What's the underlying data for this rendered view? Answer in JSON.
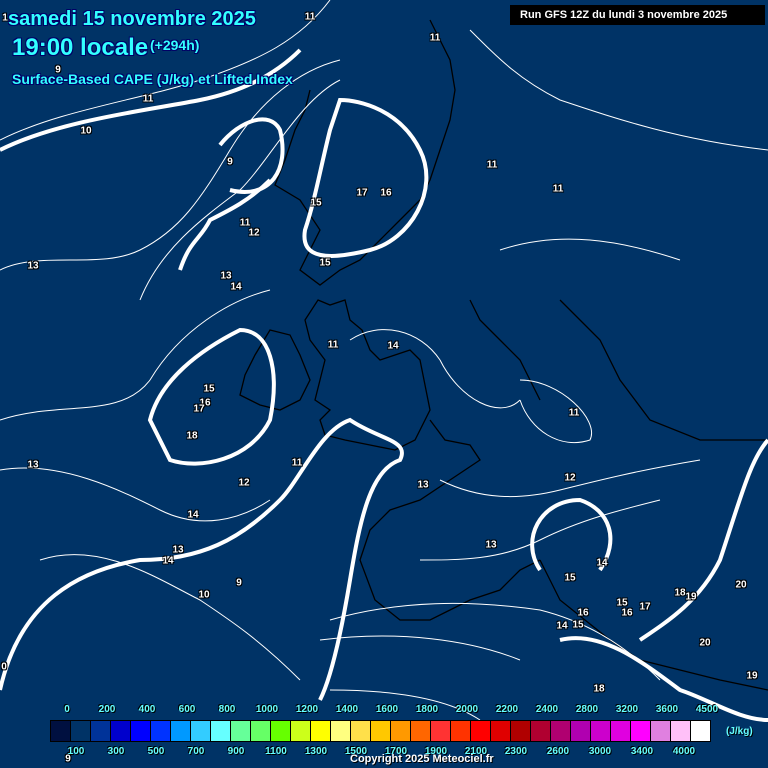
{
  "header": {
    "date": "samedi 15 novembre 2025",
    "time": "19:00 locale",
    "lead": "(+294h)",
    "parameter": "Surface-Based CAPE (J/kg) et Lifted Index",
    "run": "Run GFS 12Z du lundi 3 novembre 2025"
  },
  "contour_labels": [
    "11",
    "11",
    "1",
    "9",
    "11",
    "10",
    "9",
    "11",
    "11",
    "17",
    "16",
    "15",
    "11",
    "12",
    "15",
    "13",
    "13",
    "14",
    "11",
    "14",
    "15",
    "16",
    "17",
    "18",
    "11",
    "13",
    "11",
    "12",
    "12",
    "13",
    "14",
    "13",
    "13",
    "14",
    "14",
    "15",
    "9",
    "10",
    "18",
    "19",
    "20",
    "15",
    "17",
    "16",
    "16",
    "14",
    "15",
    "20",
    "0",
    "19",
    "18",
    "14",
    "9"
  ],
  "legend": {
    "colors": [
      "#001040",
      "#003366",
      "#003399",
      "#0000cc",
      "#0000ff",
      "#0033ff",
      "#0099ff",
      "#33ccff",
      "#66ffff",
      "#66ff99",
      "#66ff66",
      "#66ff00",
      "#ccff1a",
      "#ffff00",
      "#ffff80",
      "#ffe04a",
      "#ffc800",
      "#ff9900",
      "#ff6600",
      "#ff3333",
      "#ff3300",
      "#ff0000",
      "#e00000",
      "#b00000",
      "#b00030",
      "#b00070",
      "#b000b0",
      "#cc00cc",
      "#e000e0",
      "#ff00ff",
      "#e080e0",
      "#ffc0f8",
      "#ffffff"
    ],
    "top_labels": [
      "0",
      "200",
      "400",
      "600",
      "800",
      "1000",
      "1200",
      "1400",
      "1600",
      "1800",
      "2000",
      "2200",
      "2400",
      "2800",
      "3200",
      "3600",
      "4500"
    ],
    "bottom_labels": [
      "100",
      "300",
      "500",
      "700",
      "900",
      "1100",
      "1300",
      "1500",
      "1700",
      "1900",
      "2100",
      "2300",
      "2600",
      "3000",
      "3400",
      "4000"
    ],
    "unit": "(J/kg)"
  },
  "copyright": "Copyright 2025 Meteociel.fr"
}
